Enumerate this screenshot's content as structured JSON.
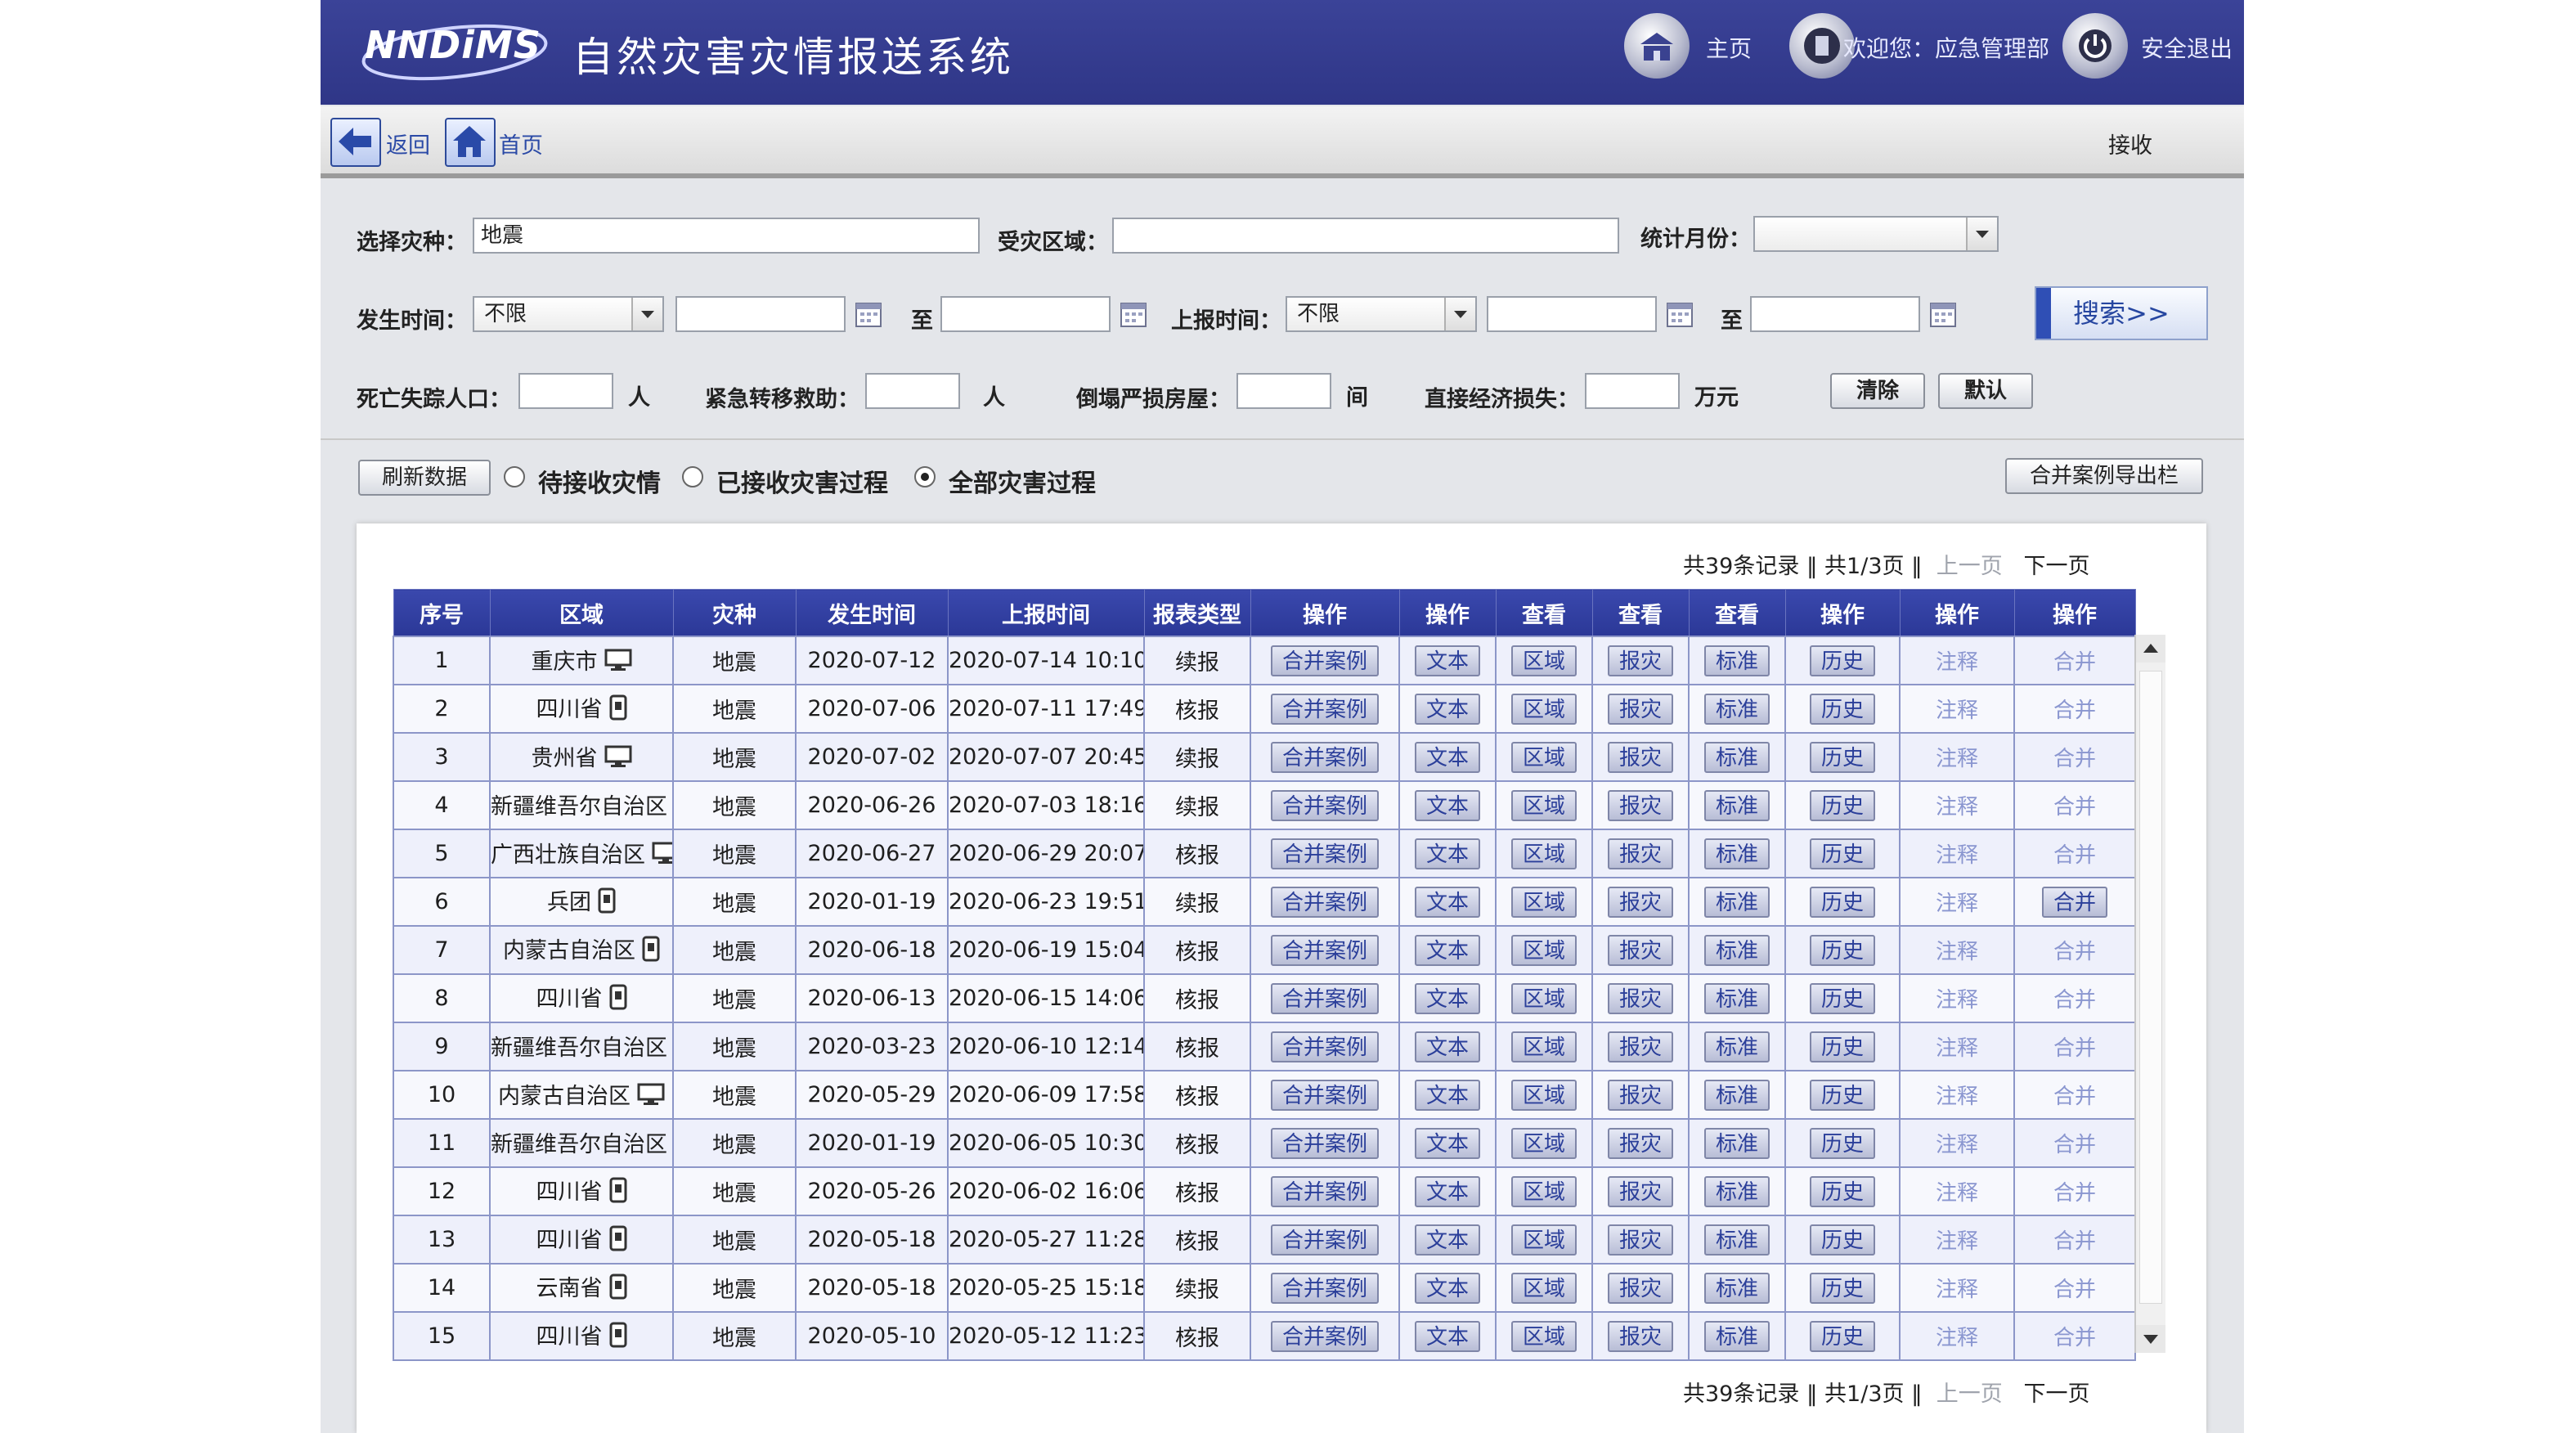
{
  "header": {
    "logo": "NNDiMS",
    "title": "自然灾害灾情报送系统",
    "home": "主页",
    "welcome": "欢迎您：应急管理部",
    "logout": "安全退出"
  },
  "nav": {
    "back": "返回",
    "home": "首页",
    "receive": "接收"
  },
  "filters": {
    "disaster_type_label": "选择灾种：",
    "disaster_type_value": "地震",
    "area_label": "受灾区域：",
    "area_value": "",
    "month_label": "统计月份：",
    "month_value": "",
    "occur_label": "发生时间：",
    "occur_select": "不限",
    "to": "至",
    "report_label": "上报时间：",
    "report_select": "不限",
    "search": "搜索>>",
    "death_label": "死亡失踪人口：",
    "person_unit": "人",
    "relocate_label": "紧急转移救助：",
    "house_label": "倒塌严损房屋：",
    "house_unit": "间",
    "loss_label": "直接经济损失：",
    "loss_unit": "万元",
    "clear": "清除",
    "default": "默认"
  },
  "options": {
    "refresh": "刷新数据",
    "pending": "待接收灾情",
    "received": "已接收灾害过程",
    "all": "全部灾害过程",
    "export": "合并案例导出栏"
  },
  "pager": {
    "total": "共39条记录",
    "page": "共1/3页",
    "prev": "上一页",
    "next": "下一页",
    "sep": "‖"
  },
  "table": {
    "columns": [
      "序号",
      "区域",
      "灾种",
      "发生时间",
      "上报时间",
      "报表类型",
      "操作",
      "操作",
      "查看",
      "查看",
      "查看",
      "操作",
      "操作",
      "操作"
    ],
    "btn_merge_case": "合并案例",
    "btn_text": "文本",
    "btn_region": "区域",
    "btn_report": "报灾",
    "btn_standard": "标准",
    "btn_history": "历史",
    "link_cancel": "注释",
    "link_merge": "合并",
    "rows": [
      {
        "no": "1",
        "region": "重庆市",
        "device": "monitor",
        "type": "地震",
        "occur": "2020-07-12",
        "report": "2020-07-14 10:10",
        "kind": "续报",
        "merge_btn": false
      },
      {
        "no": "2",
        "region": "四川省",
        "device": "phone",
        "type": "地震",
        "occur": "2020-07-06",
        "report": "2020-07-11 17:49",
        "kind": "核报",
        "merge_btn": false
      },
      {
        "no": "3",
        "region": "贵州省",
        "device": "monitor",
        "type": "地震",
        "occur": "2020-07-02",
        "report": "2020-07-07 20:45",
        "kind": "续报",
        "merge_btn": false
      },
      {
        "no": "4",
        "region": "新疆维吾尔自治区",
        "device": "monitor",
        "type": "地震",
        "occur": "2020-06-26",
        "report": "2020-07-03 18:16",
        "kind": "续报",
        "merge_btn": false
      },
      {
        "no": "5",
        "region": "广西壮族自治区",
        "device": "monitor",
        "type": "地震",
        "occur": "2020-06-27",
        "report": "2020-06-29 20:07",
        "kind": "核报",
        "merge_btn": false
      },
      {
        "no": "6",
        "region": "兵团",
        "device": "phone",
        "type": "地震",
        "occur": "2020-01-19",
        "report": "2020-06-23 19:51",
        "kind": "续报",
        "merge_btn": true
      },
      {
        "no": "7",
        "region": "内蒙古自治区",
        "device": "phone",
        "type": "地震",
        "occur": "2020-06-18",
        "report": "2020-06-19 15:04",
        "kind": "核报",
        "merge_btn": false
      },
      {
        "no": "8",
        "region": "四川省",
        "device": "phone",
        "type": "地震",
        "occur": "2020-06-13",
        "report": "2020-06-15 14:06",
        "kind": "核报",
        "merge_btn": false
      },
      {
        "no": "9",
        "region": "新疆维吾尔自治区",
        "device": "monitor",
        "type": "地震",
        "occur": "2020-03-23",
        "report": "2020-06-10 12:14",
        "kind": "核报",
        "merge_btn": false
      },
      {
        "no": "10",
        "region": "内蒙古自治区",
        "device": "monitor",
        "type": "地震",
        "occur": "2020-05-29",
        "report": "2020-06-09 17:58",
        "kind": "核报",
        "merge_btn": false
      },
      {
        "no": "11",
        "region": "新疆维吾尔自治区",
        "device": "monitor",
        "type": "地震",
        "occur": "2020-01-19",
        "report": "2020-06-05 10:30",
        "kind": "核报",
        "merge_btn": false
      },
      {
        "no": "12",
        "region": "四川省",
        "device": "phone",
        "type": "地震",
        "occur": "2020-05-26",
        "report": "2020-06-02 16:06",
        "kind": "核报",
        "merge_btn": false
      },
      {
        "no": "13",
        "region": "四川省",
        "device": "phone",
        "type": "地震",
        "occur": "2020-05-18",
        "report": "2020-05-27 11:28",
        "kind": "核报",
        "merge_btn": false
      },
      {
        "no": "14",
        "region": "云南省",
        "device": "phone",
        "type": "地震",
        "occur": "2020-05-18",
        "report": "2020-05-25 15:18",
        "kind": "续报",
        "merge_btn": false
      },
      {
        "no": "15",
        "region": "四川省",
        "device": "phone",
        "type": "地震",
        "occur": "2020-05-10",
        "report": "2020-05-12 11:23",
        "kind": "核报",
        "merge_btn": false
      }
    ]
  }
}
